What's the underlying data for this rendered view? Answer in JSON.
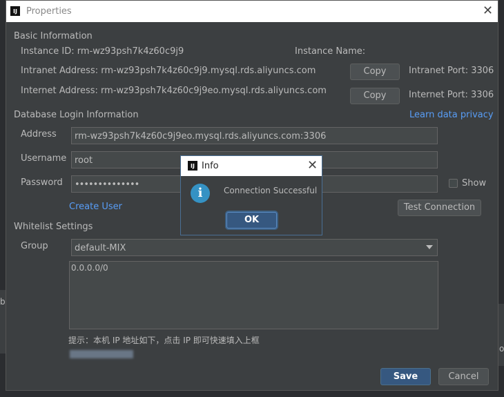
{
  "dialog": {
    "title": "Properties",
    "app_icon": "IJ"
  },
  "basic": {
    "section": "Basic Information",
    "instance_id": "Instance ID: rm-wz93psh7k4z60c9j9",
    "instance_name": "Instance Name:",
    "intranet_address": "Intranet Address: rm-wz93psh7k4z60c9j9.mysql.rds.aliyuncs.com",
    "internet_address": "Internet Address: rm-wz93psh7k4z60c9j9eo.mysql.rds.aliyuncs.com",
    "copy_label": "Copy",
    "intranet_port": "Intranet Port: 3306",
    "internet_port": "Internet Port: 3306"
  },
  "login": {
    "section": "Database Login Information",
    "privacy_link": "Learn data privacy",
    "address_label": "Address",
    "address_value": "rm-wz93psh7k4z60c9j9eo.mysql.rds.aliyuncs.com:3306",
    "username_label": "Username",
    "username_value": "root",
    "password_label": "Password",
    "password_value": "••••••••••••••",
    "show_label": "Show",
    "create_user": "Create User",
    "test_connection": "Test Connection"
  },
  "whitelist": {
    "section": "Whitelist Settings",
    "group_label": "Group",
    "group_value": "default-MIX",
    "ip_list": "0.0.0.0/0",
    "hint": "提示：本机 IP 地址如下，点击 IP 即可快速填入上框"
  },
  "footer": {
    "save": "Save",
    "cancel": "Cancel"
  },
  "info_dialog": {
    "title": "Info",
    "message": "Connection Successful",
    "ok": "OK",
    "icon": "info-icon"
  },
  "background": {
    "left_char": "b",
    "right_char": "o"
  },
  "colors": {
    "link": "#589df6",
    "primary_button": "#365880",
    "info_icon": "#3592c4",
    "dialog_bg": "#3c3f41"
  }
}
